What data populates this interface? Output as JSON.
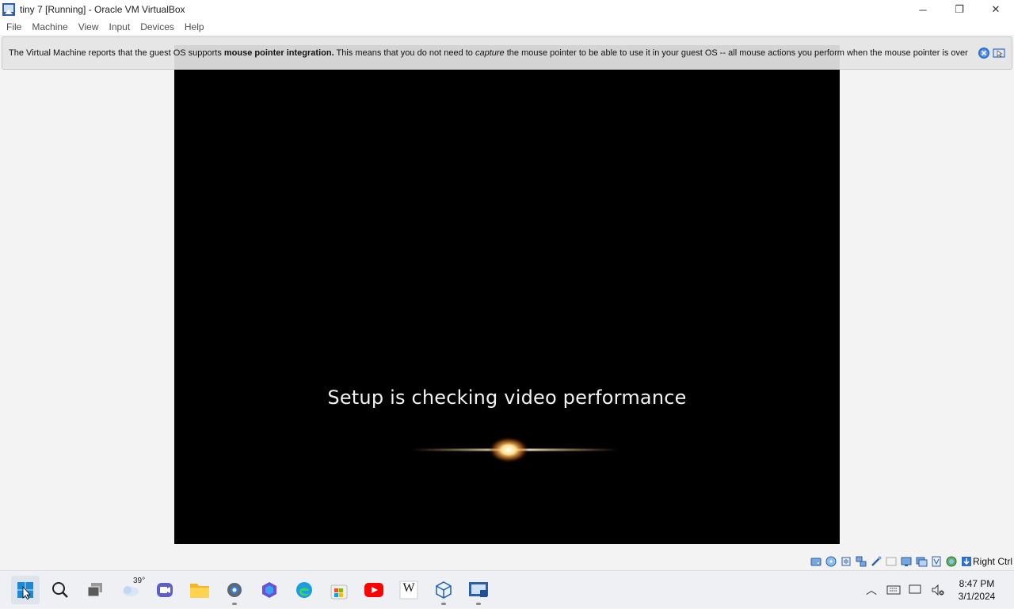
{
  "window": {
    "title": "tiny 7 [Running] - Oracle VM VirtualBox",
    "app_icon": "virtualbox-vm-icon",
    "controls": {
      "minimize": "─",
      "maximize": "❐",
      "close": "✕"
    }
  },
  "menu": {
    "items": [
      {
        "label": "File"
      },
      {
        "label": "Machine"
      },
      {
        "label": "View"
      },
      {
        "label": "Input"
      },
      {
        "label": "Devices"
      },
      {
        "label": "Help"
      }
    ]
  },
  "banner": {
    "text_before": "The Virtual Machine reports that the guest OS supports ",
    "bold": "mouse pointer integration.",
    "text_middle": " This means that you do not need to ",
    "italic": "capture",
    "text_after": " the mouse pointer to be able to use it in your guest OS -- all mouse actions you perform when the mouse pointer is over",
    "icons": [
      "close-banner-icon",
      "mouse-integration-icon"
    ]
  },
  "guest": {
    "setup_text": "Setup is checking video performance"
  },
  "statusbar": {
    "icons": [
      "hard-disk-icon",
      "optical-drive-icon",
      "audio-icon",
      "network-icon",
      "usb-icon",
      "shared-folders-icon",
      "display-icon",
      "recording-icon",
      "cpu-icon",
      "mouse-integration-icon",
      "keyboard-capture-icon"
    ],
    "host_key": "Right Ctrl"
  },
  "taskbar": {
    "weather_temp": "39°",
    "apps": [
      "start-button",
      "search-icon",
      "task-view-icon",
      "weather-icon",
      "meet-icon",
      "file-explorer-icon",
      "settings-icon",
      "copilot-icon",
      "edge-icon",
      "store-icon",
      "youtube-icon",
      "wikipedia-icon",
      "virtualbox-icon",
      "virtualbox-vm-icon"
    ],
    "wikipedia_letter": "W",
    "tray": {
      "chevron": "︿",
      "time": "8:47 PM",
      "date": "3/1/2024"
    }
  }
}
